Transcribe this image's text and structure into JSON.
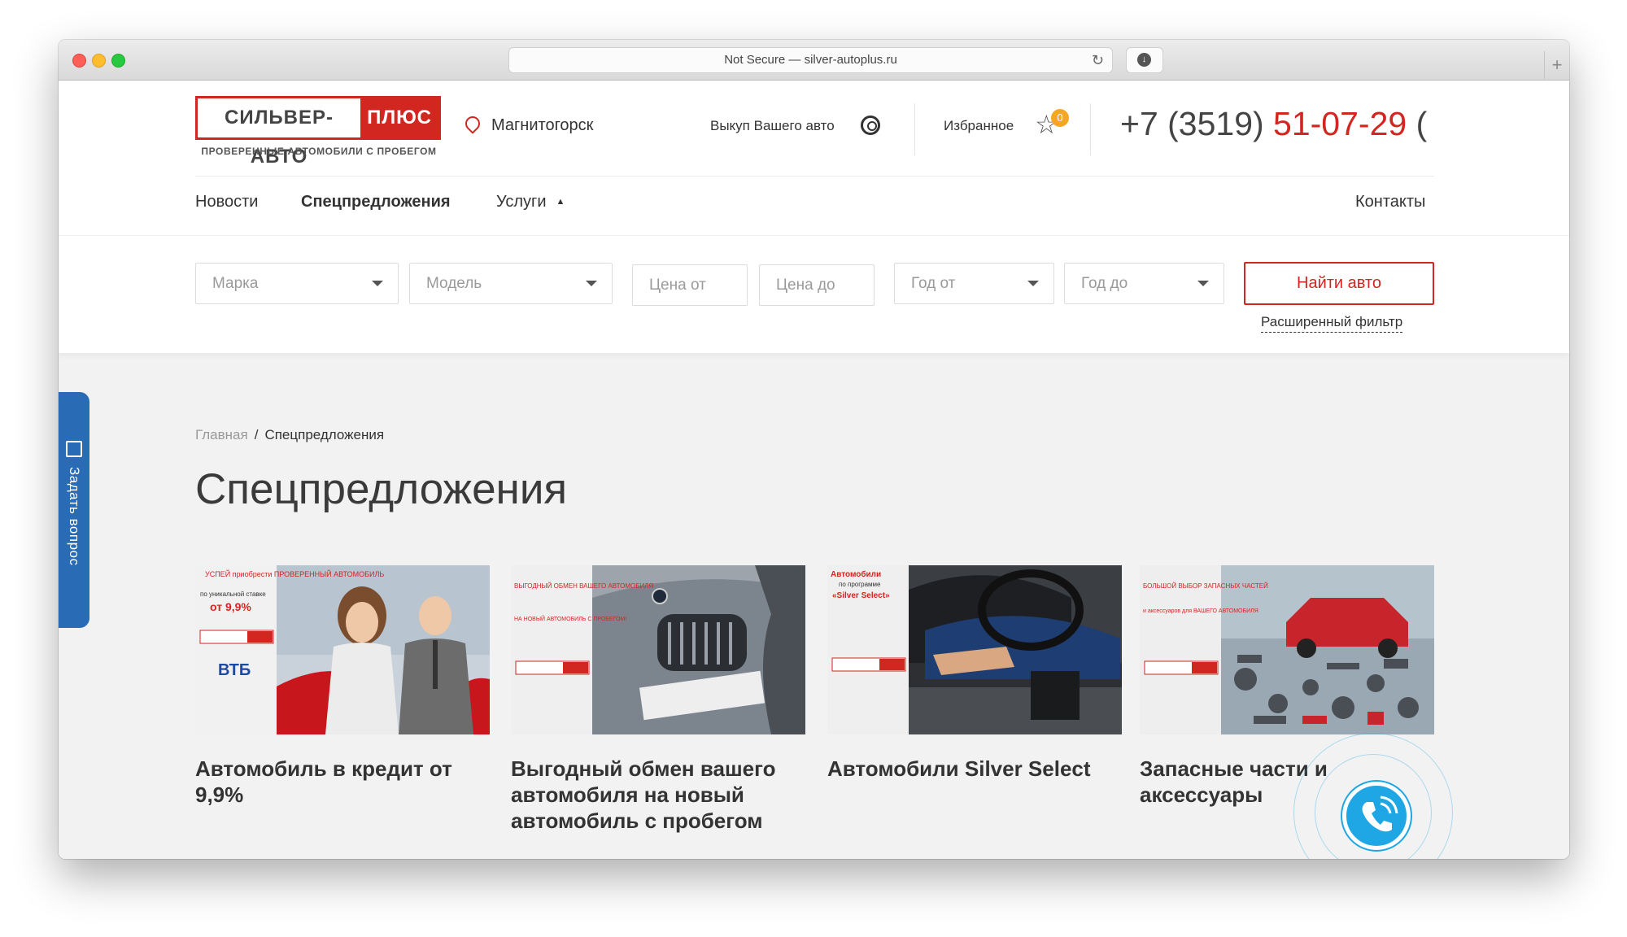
{
  "browser": {
    "url_text": "Not Secure — silver-autoplus.ru"
  },
  "header": {
    "logo_left": "СИЛЬВЕР-АВТО",
    "logo_right": "ПЛЮС",
    "logo_sub": "ПРОВЕРЕННЫЕ АВТОМОБИЛИ С ПРОБЕГОМ",
    "city": "Магнитогорск",
    "buyout": "Выкуп Вашего авто",
    "favorites": "Избранное",
    "favorites_count": "0",
    "phone_prefix": "+7 (3519) ",
    "phone_number": "51-07-29"
  },
  "nav": {
    "news": "Новости",
    "offers": "Спецпредложения",
    "services": "Услуги",
    "contacts": "Контакты"
  },
  "filter": {
    "make": "Марка",
    "model": "Модель",
    "price_from": "Цена от",
    "price_to": "Цена до",
    "year_from": "Год от",
    "year_to": "Год до",
    "search": "Найти авто",
    "advanced": "Расширенный фильтр"
  },
  "side_tab": {
    "label": "Задать вопрос"
  },
  "breadcrumb": {
    "home": "Главная",
    "sep": "/",
    "current": "Спецпредложения"
  },
  "title": "Спецпредложения",
  "cards": [
    {
      "title": "Автомобиль в кредит от 9,9%",
      "img_text_1": "УСПЕЙ приобрести ПРОВЕРЕННЫЙ АВТОМОБИЛЬ",
      "img_text_2": "по уникальной ставке",
      "img_text_3": "от 9,9%",
      "img_text_4": "ВТБ"
    },
    {
      "title": "Выгодный обмен вашего автомобиля на новый автомобиль с пробегом",
      "img_text_1": "ВЫГОДНЫЙ ОБМЕН ВАШЕГО АВТОМОБИЛЯ",
      "img_text_2": "НА НОВЫЙ АВТОМОБИЛЬ С ПРОБЕГОМ!"
    },
    {
      "title": "Автомобили Silver Select",
      "img_text_1": "Автомобили",
      "img_text_2": "по программе",
      "img_text_3": "«Silver Select»"
    },
    {
      "title": "Запасные части и аксессуары",
      "img_text_1": "БОЛЬШОЙ ВЫБОР ЗАПАСНЫХ ЧАСТЕЙ",
      "img_text_2": "и аксессуаров для ВАШЕГО АВТОМОБИЛЯ"
    }
  ],
  "colors": {
    "brand_red": "#d22620",
    "side_tab_blue": "#2a6bb5",
    "call_blue": "#1ea7e4",
    "badge_orange": "#f5a623"
  },
  "icons": [
    "location-pin-icon",
    "steering-wheel-icon",
    "star-icon",
    "envelope-icon",
    "phone-call-icon",
    "chevron-up-icon",
    "dropdown-arrow-icon",
    "reload-icon",
    "download-icon",
    "plus-icon"
  ]
}
